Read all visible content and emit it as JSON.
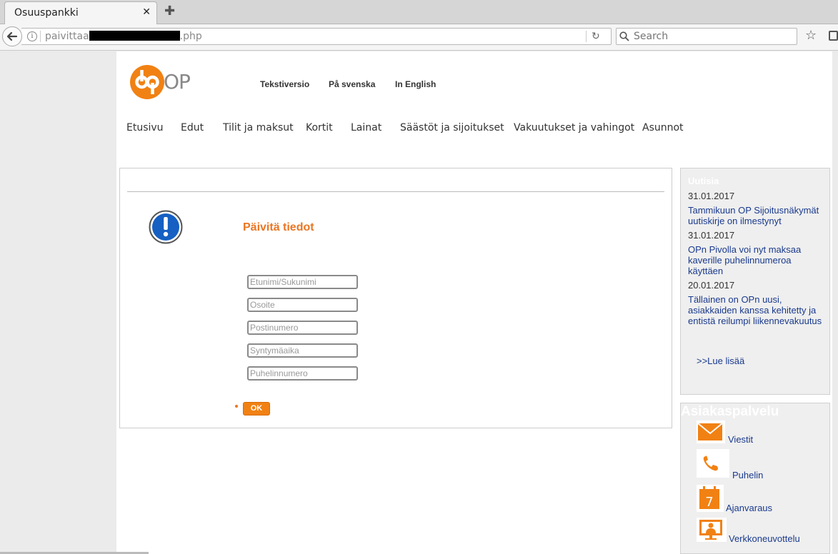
{
  "browser": {
    "tab_title": "Osuuspankki",
    "url_prefix": "paivittaa",
    "url_suffix": ".php",
    "search_placeholder": "Search"
  },
  "header": {
    "logo_text": "OP",
    "links": [
      "Tekstiversio",
      "På svenska",
      "In English"
    ]
  },
  "nav": [
    "Etusivu",
    "Edut",
    "Tilit ja maksut",
    "Kortit",
    "Lainat",
    "Säästöt ja sijoitukset",
    "Vakuutukset ja vahingot",
    "Asunnot"
  ],
  "form": {
    "title": "Päivitä tiedot",
    "fields": [
      "Etunimi/Sukunimi",
      "Osoite",
      "Postinumero",
      "Syntymäaika",
      "Puhelinnumero"
    ],
    "submit_label": "OK"
  },
  "news": {
    "heading": "Uutisia",
    "items": [
      {
        "date": "31.01.2017",
        "text": "Tammikuun OP Sijoitusnäkymät uutiskirje on ilmestynyt"
      },
      {
        "date": "31.01.2017",
        "text": "OPn Pivolla voi nyt maksaa kaverille puhelinnumeroa käyttäen"
      },
      {
        "date": "20.01.2017",
        "text": "Tällainen on OPn uusi, asiakkaiden kanssa kehitetty ja entistä reilumpi liikennevakuutus"
      }
    ],
    "more": ">>Lue lisää"
  },
  "service": {
    "heading": "Asiakaspalvelu",
    "items": [
      {
        "label": "Viestit",
        "icon": "mail-icon"
      },
      {
        "label": "Puhelin",
        "icon": "phone-icon"
      },
      {
        "label": "Ajanvaraus",
        "icon": "calendar-icon",
        "calendar_day": "7"
      },
      {
        "label": "Verkkoneuvottelu",
        "icon": "monitor-person-icon"
      }
    ]
  },
  "colors": {
    "accent": "#ea7623",
    "link": "#1a3a8c"
  }
}
